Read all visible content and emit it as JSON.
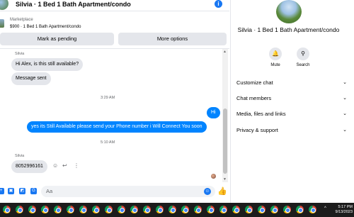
{
  "header": {
    "title": "Silvia · 1 Bed 1 Bath Apartment/condo",
    "info_icon": "info-icon"
  },
  "marketplace": {
    "label": "Marketplace",
    "item": "$900 · 1 Bed 1 Bath Apartment/condo"
  },
  "actions": {
    "pending_label": "Mark as pending",
    "more_label": "More options"
  },
  "messages": {
    "sender1": "Silvia",
    "msg1": "Hi Alex, is this still available?",
    "msg2": "Message sent",
    "time1": "3:29 AM",
    "out1": "Hi",
    "out2": "yes its Still Available please send your Phone number i Will Connect You soon",
    "time2": "5:10 AM",
    "sender2": "Silvia",
    "msg3": "8052996161"
  },
  "composer": {
    "placeholder": "Aa"
  },
  "panel": {
    "name": "Silvia · 1 Bed 1 Bath Apartment/condo",
    "mute_label": "Mute",
    "search_label": "Search",
    "rows": [
      "Customize chat",
      "Chat members",
      "Media, files and links",
      "Privacy & support"
    ]
  },
  "taskbar": {
    "time": "5:17 PM",
    "date": "9/13/2023"
  },
  "colors": {
    "accent": "#1877f2",
    "outgoing_bubble": "#0084ff",
    "incoming_bubble": "#e4e6eb"
  }
}
